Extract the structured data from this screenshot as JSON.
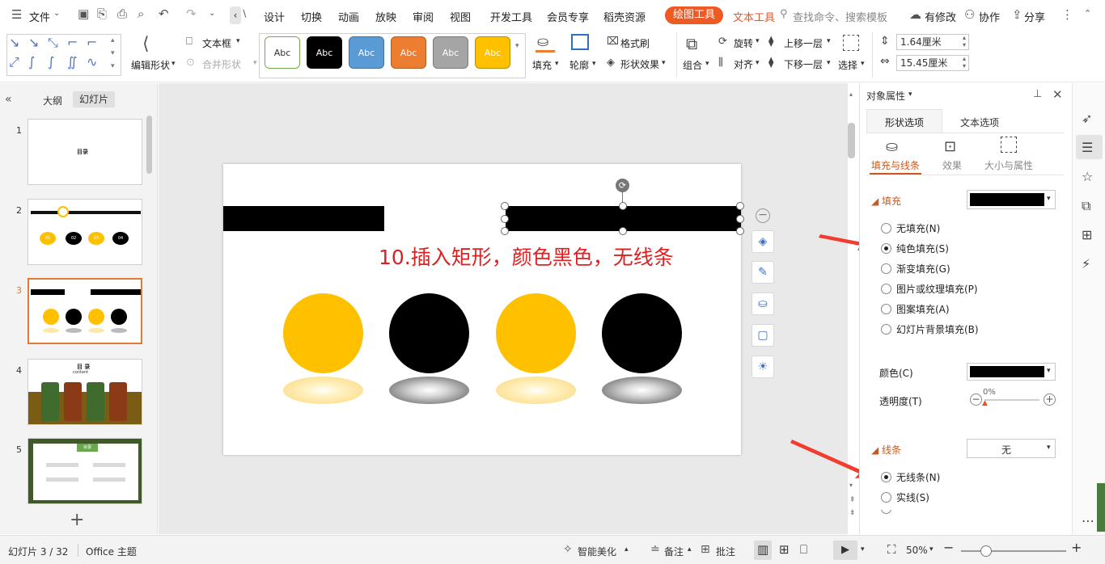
{
  "menubar": {
    "file_label": "文件",
    "tabs": [
      "设计",
      "切换",
      "动画",
      "放映",
      "审阅",
      "视图",
      "开发工具",
      "会员专享",
      "稻壳资源"
    ],
    "active_tab": "绘图工具",
    "text_tool_tab": "文本工具",
    "search_placeholder": "查找命令、搜索模板",
    "modified_label": "有修改",
    "collab_label": "协作",
    "share_label": "分享"
  },
  "ribbon": {
    "edit_shape": "编辑形状",
    "text_box": "文本框",
    "merge_shape": "合并形状",
    "styles": [
      {
        "label": "Abc",
        "bg": "#ffffff",
        "fg": "#333333",
        "border": "#70ad47"
      },
      {
        "label": "Abc",
        "bg": "#000000",
        "fg": "#ffffff",
        "border": "#000000"
      },
      {
        "label": "Abc",
        "bg": "#5b9bd5",
        "fg": "#ffffff",
        "border": "#41719c"
      },
      {
        "label": "Abc",
        "bg": "#ed7d31",
        "fg": "#ffffff",
        "border": "#ae5a21"
      },
      {
        "label": "Abc",
        "bg": "#a5a5a5",
        "fg": "#ffffff",
        "border": "#7b7b7b"
      },
      {
        "label": "Abc",
        "bg": "#ffc000",
        "fg": "#ffffff",
        "border": "#bc8c00"
      }
    ],
    "fill": "填充",
    "outline": "轮廓",
    "format_painter": "格式刷",
    "shape_effect": "形状效果",
    "group": "组合",
    "rotate": "旋转",
    "align": "对齐",
    "bring_forward": "上移一层",
    "send_backward": "下移一层",
    "select": "选择",
    "height_value": "1.64厘米",
    "width_value": "15.45厘米"
  },
  "leftpanel": {
    "outline_tab": "大纲",
    "slides_tab": "幻灯片",
    "slide_numbers": [
      "1",
      "2",
      "3",
      "4",
      "5"
    ],
    "slide1_title": "目录",
    "slide2_labels": [
      "01",
      "02",
      "03",
      "04"
    ],
    "slide4_title": "目 录",
    "slide4_subtitle": "content",
    "slide5_badge": "目录"
  },
  "slide": {
    "annotation": "10.插入矩形，颜色黑色，无线条",
    "colors": {
      "black": "#000000",
      "yellow": "#ffc000",
      "annotation": "#e02020"
    }
  },
  "rightpanel": {
    "title": "对象属性",
    "tab_shape": "形状选项",
    "tab_text": "文本选项",
    "sub_fill_line": "填充与线条",
    "sub_effect": "效果",
    "sub_size": "大小与属性",
    "fill_section": "填充",
    "fill_options": [
      "无填充(N)",
      "纯色填充(S)",
      "渐变填充(G)",
      "图片或纹理填充(P)",
      "图案填充(A)",
      "幻灯片背景填充(B)"
    ],
    "color_label": "颜色(C)",
    "transparency_label": "透明度(T)",
    "transparency_value": "0%",
    "line_section": "线条",
    "line_value": "无",
    "line_options": [
      "无线条(N)",
      "实线(S)"
    ]
  },
  "statusbar": {
    "slide_info": "幻灯片 3 / 32",
    "theme": "Office 主题",
    "smart_beautify": "智能美化",
    "notes": "备注",
    "comments": "批注",
    "zoom": "50%"
  }
}
